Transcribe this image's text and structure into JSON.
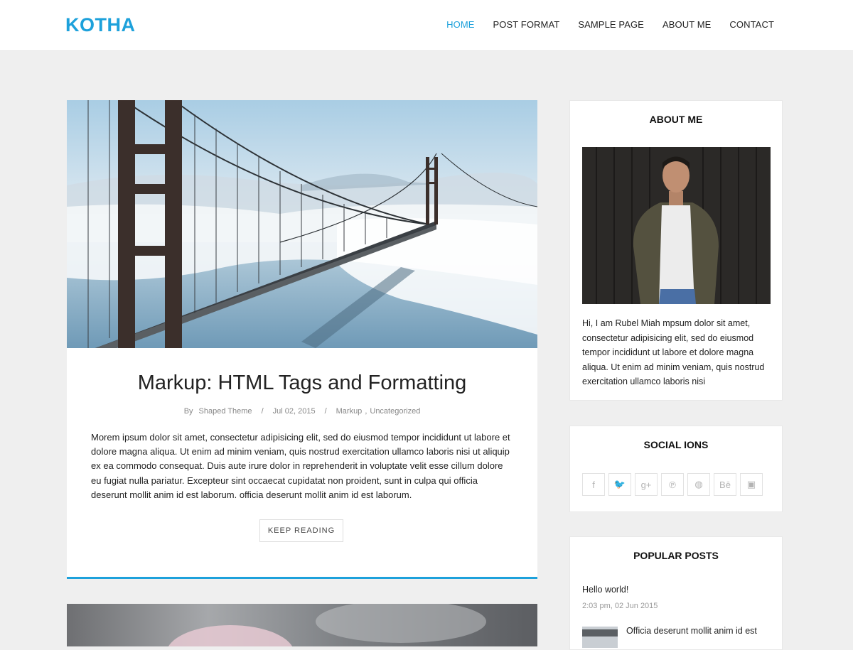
{
  "site": {
    "brand": "KOTHA",
    "accent_color": "#1da1db"
  },
  "nav": {
    "items": [
      {
        "label": "HOME",
        "active": true
      },
      {
        "label": "POST FORMAT",
        "active": false
      },
      {
        "label": "SAMPLE PAGE",
        "active": false
      },
      {
        "label": "ABOUT ME",
        "active": false
      },
      {
        "label": "CONTACT",
        "active": false
      }
    ]
  },
  "post": {
    "image": "golden-gate-bridge-in-fog",
    "title": "Markup: HTML Tags and Formatting",
    "meta": {
      "by_label": "By",
      "author": "Shaped Theme",
      "date": "Jul 02, 2015",
      "categories": [
        "Markup",
        "Uncategorized"
      ]
    },
    "excerpt": "Morem ipsum dolor sit amet, consectetur adipisicing elit, sed do eiusmod tempor incididunt ut labore et dolore magna aliqua. Ut enim ad minim veniam, quis nostrud exercitation ullamco laboris nisi ut aliquip ex ea commodo consequat. Duis aute irure dolor in reprehenderit in voluptate velit esse cillum dolore eu fugiat nulla pariatur. Excepteur sint occaecat cupidatat non proident, sunt in culpa qui officia deserunt mollit anim id est laborum. officia deserunt mollit anim id est laborum.",
    "read_more_label": "KEEP READING"
  },
  "sidebar": {
    "about": {
      "title": "ABOUT ME",
      "photo": "portrait-man-dark-wood-background",
      "text": "Hi, I am Rubel Miah mpsum dolor sit amet, consectetur adipisicing elit, sed do eiusmod tempor incididunt ut labore et dolore magna aliqua. Ut enim ad minim veniam, quis nostrud exercitation ullamco laboris nisi"
    },
    "social": {
      "title": "SOCIAL IONS",
      "icons": [
        {
          "name": "facebook-icon",
          "glyph": "f"
        },
        {
          "name": "twitter-icon",
          "glyph": "🐦"
        },
        {
          "name": "google-plus-icon",
          "glyph": "g+"
        },
        {
          "name": "pinterest-icon",
          "glyph": "℗"
        },
        {
          "name": "dribbble-icon",
          "glyph": "◍"
        },
        {
          "name": "behance-icon",
          "glyph": "Bē"
        },
        {
          "name": "youtube-icon",
          "glyph": "▣"
        }
      ]
    },
    "popular": {
      "title": "POPULAR POSTS",
      "items": [
        {
          "title": "Hello world!",
          "date": "2:03 pm, 02 Jun 2015"
        },
        {
          "title": "Officia deserunt mollit anim id est"
        }
      ]
    }
  }
}
